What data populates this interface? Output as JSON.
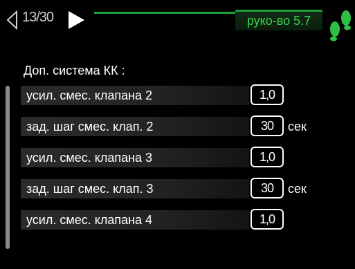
{
  "header": {
    "page_counter": "13/30",
    "menu_badge": "руко-во 5.7",
    "accent_color": "#1e9f3a",
    "icons": {
      "prev": "triangle-left-outline-icon",
      "next": "triangle-right-icon",
      "footprints": "footprints-icon"
    }
  },
  "section": {
    "title": "Доп. система КК :"
  },
  "rows": [
    {
      "label": "усил. смес. клапана 2",
      "value": "1,0",
      "unit": ""
    },
    {
      "label": "зад. шаг смес. клап. 2",
      "value": "30",
      "unit": "сек"
    },
    {
      "label": "усил. смес. клапана 3",
      "value": "1,0",
      "unit": ""
    },
    {
      "label": "зад. шаг смес. клап. 3",
      "value": "30",
      "unit": "сек"
    },
    {
      "label": "усил. смес. клапана 4",
      "value": "1,0",
      "unit": ""
    }
  ]
}
